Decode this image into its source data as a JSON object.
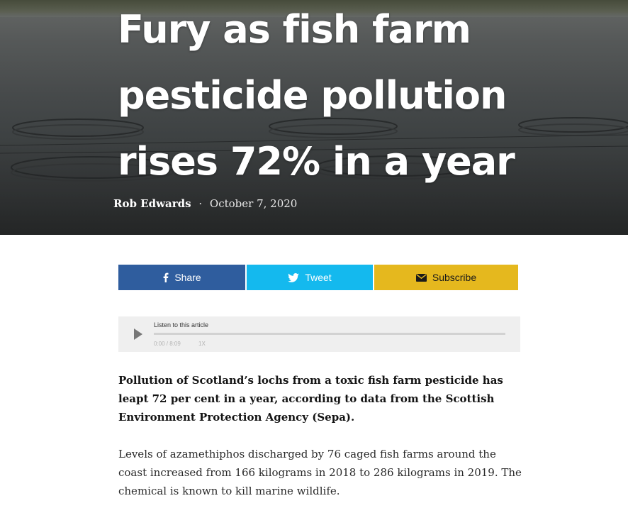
{
  "article": {
    "headline": "Fury as fish farm pesticide pollution rises 72% in a year",
    "author": "Rob Edwards",
    "separator": "·",
    "date": "October 7, 2020",
    "lede": "Pollution of Scotland’s lochs from a toxic fish farm pesticide has leapt 72 per cent in a year, according to data from the Scottish Environment Protection Agency (Sepa).",
    "paragraph_1": "Levels of azamethiphos discharged by 76 caged fish farms around the coast increased from 166 kilograms in 2018 to 286 kilograms in 2019. The chemical is known to kill marine wildlife."
  },
  "share": {
    "facebook_label": "Share",
    "twitter_label": "Tweet",
    "subscribe_label": "Subscribe",
    "facebook_icon": "facebook-icon",
    "twitter_icon": "twitter-icon",
    "subscribe_icon": "envelope-icon",
    "colors": {
      "facebook": "#2f5d9e",
      "twitter": "#14b9ee",
      "subscribe": "#e5b81e"
    }
  },
  "audio_player": {
    "label": "Listen to this article",
    "time": "0:00 / 8:09",
    "speed": "1X",
    "progress": 0,
    "play_icon": "play-icon"
  }
}
